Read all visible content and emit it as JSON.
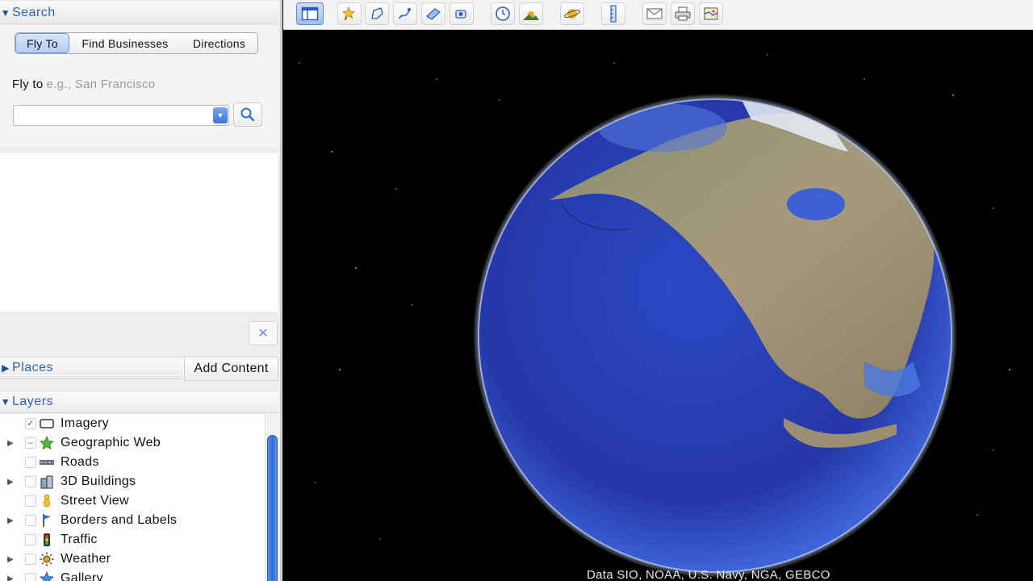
{
  "search": {
    "header": "Search",
    "tabs": [
      "Fly To",
      "Find Businesses",
      "Directions"
    ],
    "fly_label": "Fly to",
    "fly_placeholder": "e.g., San Francisco",
    "fly_value": ""
  },
  "places": {
    "header": "Places",
    "add_content": "Add Content"
  },
  "layers": {
    "header": "Layers",
    "items": [
      {
        "label": "Imagery",
        "checked": true,
        "expandable": false,
        "icon": "imagery-icon"
      },
      {
        "label": "Geographic Web",
        "checked": "partial",
        "expandable": true,
        "icon": "star-icon"
      },
      {
        "label": "Roads",
        "checked": false,
        "expandable": false,
        "icon": "road-icon"
      },
      {
        "label": "3D Buildings",
        "checked": false,
        "expandable": true,
        "icon": "building-icon"
      },
      {
        "label": "Street View",
        "checked": false,
        "expandable": false,
        "icon": "pegman-icon"
      },
      {
        "label": "Borders and Labels",
        "checked": false,
        "expandable": true,
        "icon": "flag-icon"
      },
      {
        "label": "Traffic",
        "checked": false,
        "expandable": false,
        "icon": "traffic-light-icon"
      },
      {
        "label": "Weather",
        "checked": false,
        "expandable": true,
        "icon": "sun-icon"
      },
      {
        "label": "Gallery",
        "checked": false,
        "expandable": true,
        "icon": "gallery-icon"
      }
    ]
  },
  "toolbar": {
    "buttons": [
      "sidebar-toggle",
      "placemark",
      "polygon",
      "path",
      "image-overlay",
      "record-tour",
      "historical-imagery",
      "sunlight",
      "planets",
      "ruler",
      "email",
      "print",
      "view-in-maps"
    ]
  },
  "map": {
    "attribution": "Data SIO, NOAA, U.S. Navy, NGA, GEBCO"
  },
  "colors": {
    "accent": "#2e63b8",
    "space": "#000000",
    "ocean": "#2a3fb8"
  }
}
